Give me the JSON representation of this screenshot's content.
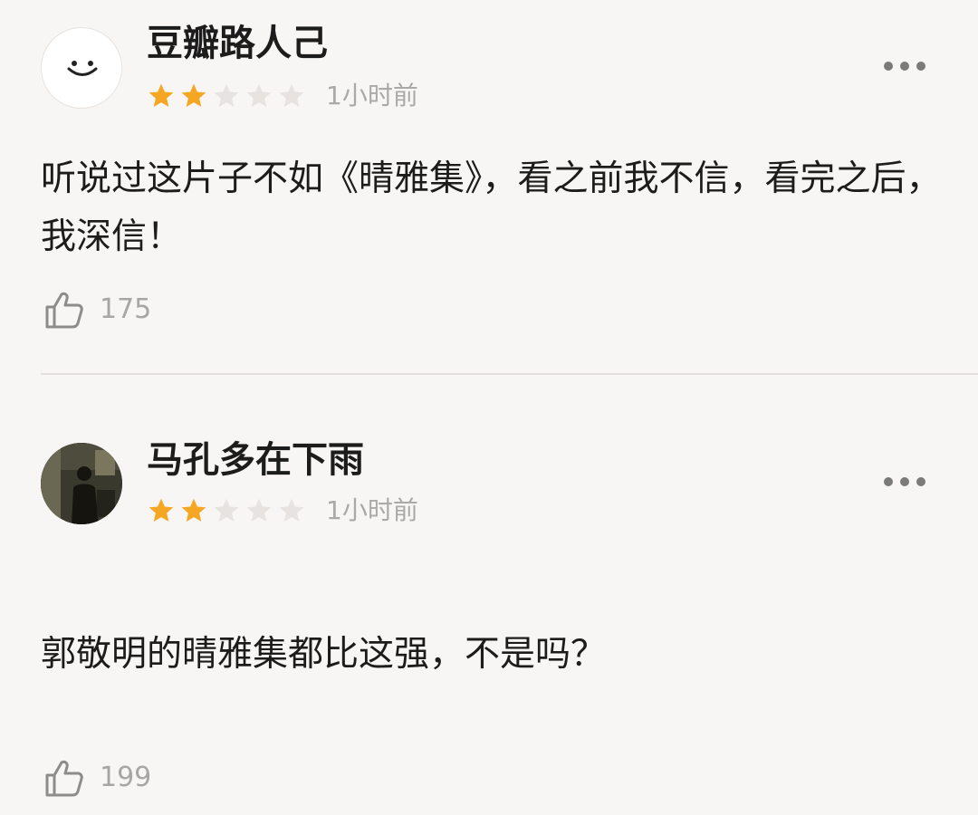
{
  "comments": [
    {
      "username": "豆瓣路人己",
      "avatar_icon": "smiley-face-icon",
      "rating": 2,
      "rating_max": 5,
      "time": "1小时前",
      "content": "听说过这片子不如《晴雅集》，看之前我不信，看完之后，我深信！",
      "likes": "175",
      "more_icon": "more-dots-icon",
      "like_icon": "thumbs-up-icon"
    },
    {
      "username": "马孔多在下雨",
      "avatar_icon": "photo-avatar",
      "rating": 2,
      "rating_max": 5,
      "time": "1小时前",
      "content": "郭敬明的晴雅集都比这强，不是吗？",
      "likes": "199",
      "more_icon": "more-dots-icon",
      "like_icon": "thumbs-up-icon"
    }
  ],
  "colors": {
    "background": "#f8f6f4",
    "star_filled": "#f5a623",
    "star_empty": "#e6e3e0",
    "muted_text": "#a9a9a9",
    "divider": "#e2dfdc"
  }
}
